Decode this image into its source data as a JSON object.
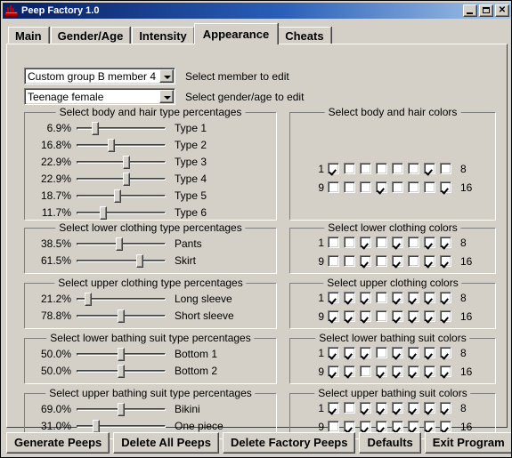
{
  "window": {
    "title": "Peep Factory 1.0",
    "icon": "factory-icon",
    "minimize_label": "",
    "maximize_label": "",
    "close_label": "✕"
  },
  "tabs": [
    {
      "label": "Main",
      "selected": false
    },
    {
      "label": "Gender/Age",
      "selected": false
    },
    {
      "label": "Intensity",
      "selected": false
    },
    {
      "label": "Appearance",
      "selected": true
    },
    {
      "label": "Cheats",
      "selected": false
    }
  ],
  "selectors": [
    {
      "value": "Custom group B member 4",
      "hint": "Select member to edit"
    },
    {
      "value": "Teenage female",
      "hint": "Select gender/age to edit"
    }
  ],
  "slider_groups": [
    {
      "title": "Select body and hair type percentages",
      "rows": [
        {
          "pct": "6.9%",
          "label": "Type 1",
          "pos": 18
        },
        {
          "pct": "16.8%",
          "label": "Type 2",
          "pos": 38
        },
        {
          "pct": "22.9%",
          "label": "Type 3",
          "pos": 56
        },
        {
          "pct": "22.9%",
          "label": "Type 4",
          "pos": 56
        },
        {
          "pct": "18.7%",
          "label": "Type 5",
          "pos": 46
        },
        {
          "pct": "11.7%",
          "label": "Type 6",
          "pos": 28
        }
      ]
    },
    {
      "title": "Select lower clothing type percentages",
      "rows": [
        {
          "pct": "38.5%",
          "label": "Pants",
          "pos": 48
        },
        {
          "pct": "61.5%",
          "label": "Skirt",
          "pos": 73
        }
      ]
    },
    {
      "title": "Select upper clothing type percentages",
      "rows": [
        {
          "pct": "21.2%",
          "label": "Long sleeve",
          "pos": 10
        },
        {
          "pct": "78.8%",
          "label": "Short sleeve",
          "pos": 50
        }
      ]
    },
    {
      "title": "Select lower bathing suit type percentages",
      "rows": [
        {
          "pct": "50.0%",
          "label": "Bottom 1",
          "pos": 50
        },
        {
          "pct": "50.0%",
          "label": "Bottom 2",
          "pos": 50
        }
      ]
    },
    {
      "title": "Select upper bathing suit type percentages",
      "rows": [
        {
          "pct": "69.0%",
          "label": "Bikini",
          "pos": 50
        },
        {
          "pct": "31.0%",
          "label": "One piece",
          "pos": 20
        }
      ]
    }
  ],
  "color_groups": [
    {
      "title": "Select body and hair colors",
      "row1_start": "1",
      "row1_end": "8",
      "row2_start": "9",
      "row2_end": "16",
      "row1": [
        true,
        false,
        false,
        false,
        false,
        false,
        true,
        false
      ],
      "row2": [
        false,
        false,
        false,
        true,
        false,
        false,
        false,
        true
      ]
    },
    {
      "title": "Select lower clothing colors",
      "row1_start": "1",
      "row1_end": "8",
      "row2_start": "9",
      "row2_end": "16",
      "row1": [
        false,
        false,
        true,
        false,
        true,
        false,
        true,
        true
      ],
      "row2": [
        false,
        false,
        true,
        false,
        true,
        false,
        true,
        true
      ]
    },
    {
      "title": "Select upper clothing colors",
      "row1_start": "1",
      "row1_end": "8",
      "row2_start": "9",
      "row2_end": "16",
      "row1": [
        true,
        true,
        true,
        false,
        true,
        true,
        true,
        true
      ],
      "row2": [
        true,
        true,
        true,
        false,
        true,
        true,
        true,
        true
      ]
    },
    {
      "title": "Select lower bathing suit colors",
      "row1_start": "1",
      "row1_end": "8",
      "row2_start": "9",
      "row2_end": "16",
      "row1": [
        true,
        true,
        true,
        false,
        true,
        true,
        true,
        true
      ],
      "row2": [
        true,
        true,
        false,
        true,
        true,
        true,
        true,
        true
      ]
    },
    {
      "title": "Select upper bathing suit colors",
      "row1_start": "1",
      "row1_end": "8",
      "row2_start": "9",
      "row2_end": "16",
      "row1": [
        true,
        false,
        true,
        true,
        true,
        true,
        true,
        true
      ],
      "row2": [
        false,
        true,
        true,
        true,
        true,
        true,
        true,
        true
      ]
    }
  ],
  "buttons": [
    {
      "label": "Generate Peeps"
    },
    {
      "label": "Delete All Peeps"
    },
    {
      "label": "Delete Factory Peeps"
    },
    {
      "label": "Defaults"
    },
    {
      "label": "Exit Program"
    }
  ],
  "colors": {
    "face": "#d4d0c8",
    "title_start": "#0a246a",
    "title_end": "#a6c6e8",
    "shadow": "#808080",
    "dark": "#404040",
    "light": "#ffffff",
    "icon_red": "#c00000"
  }
}
